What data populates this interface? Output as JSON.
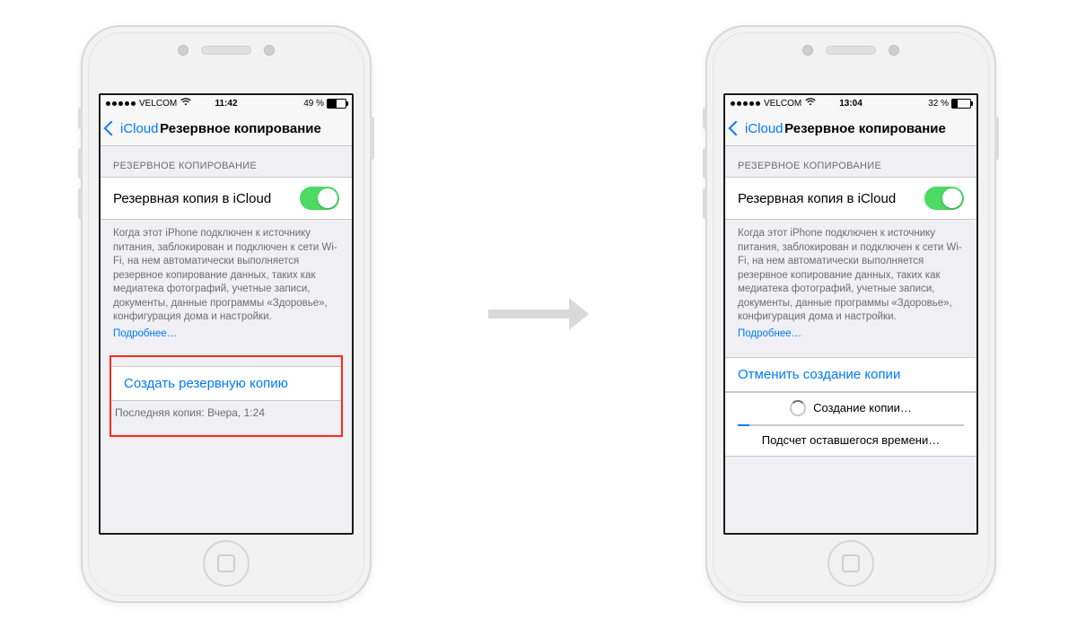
{
  "left": {
    "status": {
      "carrier": "VELCOM",
      "time": "11:42",
      "battery_text": "49 %",
      "battery_fill_pct": 49
    },
    "nav": {
      "back_label": "iCloud",
      "title": "Резервное копирование"
    },
    "section": {
      "header": "РЕЗЕРВНОЕ КОПИРОВАНИЕ",
      "toggle_label": "Резервная копия в iCloud",
      "toggle_on": true,
      "description": "Когда этот iPhone подключен к источнику питания, заблокирован и подключен к сети Wi-Fi, на нем автоматически выполняется резервное копирование данных, таких как медиатека фотографий, учетные записи, документы, данные программы «Здоровье», конфигурация дома и настройки.",
      "more_link": "Подробнее…"
    },
    "action": {
      "label": "Создать резервную копию",
      "last_backup": "Последняя копия: Вчера, 1:24"
    }
  },
  "right": {
    "status": {
      "carrier": "VELCOM",
      "time": "13:04",
      "battery_text": "32 %",
      "battery_fill_pct": 32
    },
    "nav": {
      "back_label": "iCloud",
      "title": "Резервное копирование"
    },
    "section": {
      "header": "РЕЗЕРВНОЕ КОПИРОВАНИЕ",
      "toggle_label": "Резервная копия в iCloud",
      "toggle_on": true,
      "description": "Когда этот iPhone подключен к источнику питания, заблокирован и подключен к сети Wi-Fi, на нем автоматически выполняется резервное копирование данных, таких как медиатека фотографий, учетные записи, документы, данные программы «Здоровье», конфигурация дома и настройки.",
      "more_link": "Подробнее…"
    },
    "action": {
      "cancel_label": "Отменить создание копии",
      "progress_label": "Создание копии…",
      "estimating_label": "Подсчет оставшегося времени…",
      "progress_pct": 5
    }
  }
}
